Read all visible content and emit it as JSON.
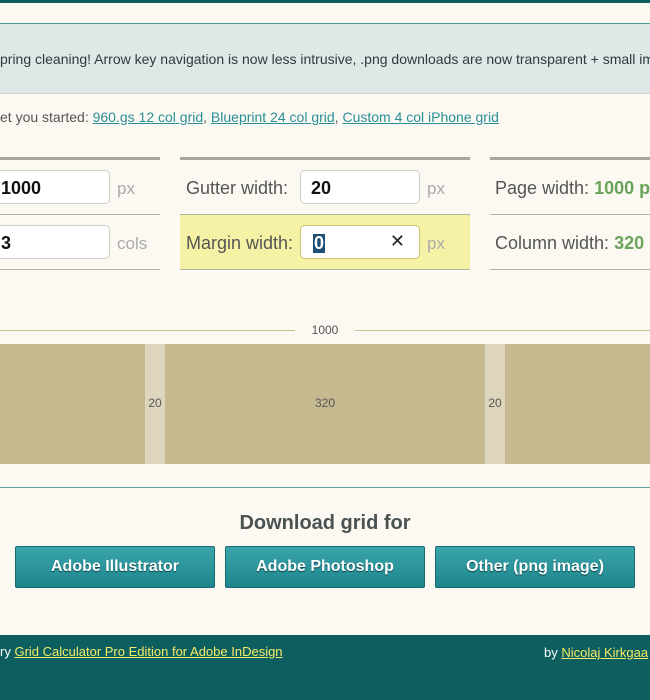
{
  "notice": {
    "text": "pring cleaning! Arrow key navigation is now less intrusive, .png downloads are now transparent + small im"
  },
  "presets": {
    "lead": "et you started: ",
    "links": [
      "960.gs 12 col grid",
      "Blueprint 24 col grid",
      "Custom 4 col iPhone grid"
    ],
    "separator": ","
  },
  "settings": {
    "width_value": "1000",
    "width_unit": "px",
    "columns_value": "3",
    "columns_unit": "cols",
    "gutter_label": "Gutter width:",
    "gutter_value": "20",
    "gutter_unit": "px",
    "margin_label": "Margin width:",
    "margin_value": "0",
    "margin_unit": "px",
    "clear_symbol": "✕",
    "page_width_label": "Page width: ",
    "page_width_value": "1000 p",
    "column_width_label": "Column width: ",
    "column_width_value": "320"
  },
  "preview": {
    "total_label": "1000",
    "gutter_label": "20",
    "column_label": "320",
    "colors": {
      "column": "#c5ba8f",
      "gutter": "#ddd6bd",
      "ruler": "#c7c08e"
    }
  },
  "download": {
    "heading": "Download grid for",
    "buttons": [
      "Adobe Illustrator",
      "Adobe Photoshop",
      "Other (png image)"
    ]
  },
  "footer": {
    "left_prefix": "ry ",
    "left_link": "Grid Calculator Pro Edition for Adobe InDesign",
    "right_prefix": "by ",
    "right_link": "Nicolaj Kirkgaa"
  },
  "colors": {
    "accent": "#2a8f96",
    "footer_bg": "#0d5e5e",
    "highlight": "#f6f2a5",
    "value_green": "#6aa35a"
  }
}
